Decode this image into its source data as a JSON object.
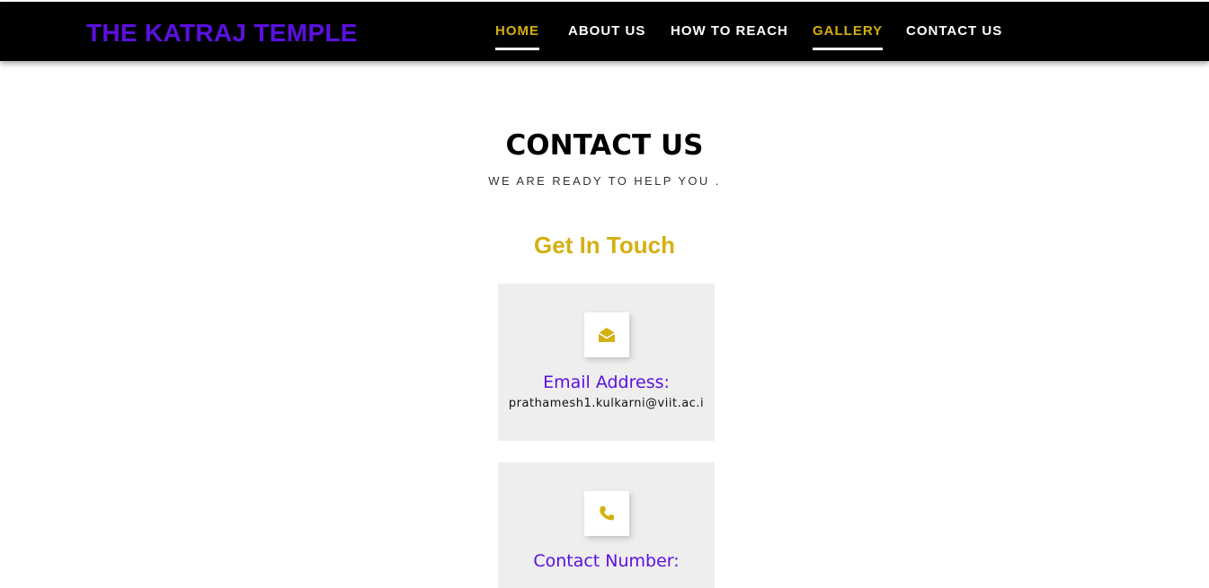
{
  "brand": {
    "title": "THE KATRAJ TEMPLE",
    "color": "#5b10e0"
  },
  "nav": {
    "items": [
      {
        "label": "HOME"
      },
      {
        "label": "ABOUT US"
      },
      {
        "label": "HOW TO REACH"
      },
      {
        "label": "GALLERY"
      },
      {
        "label": "CONTACT US"
      }
    ],
    "active_color": "#d4af11"
  },
  "contact": {
    "title": "CONTACT US",
    "subtitle": "WE ARE READY TO HELP YOU .",
    "touch_title": "Get In Touch",
    "cards": [
      {
        "icon": "envelope-open-icon",
        "label": "Email Address:",
        "value": "prathamesh1.kulkarni@viit.ac.i"
      },
      {
        "icon": "phone-icon",
        "label": "Contact Number:"
      }
    ],
    "accent_color": "#d4b012"
  }
}
